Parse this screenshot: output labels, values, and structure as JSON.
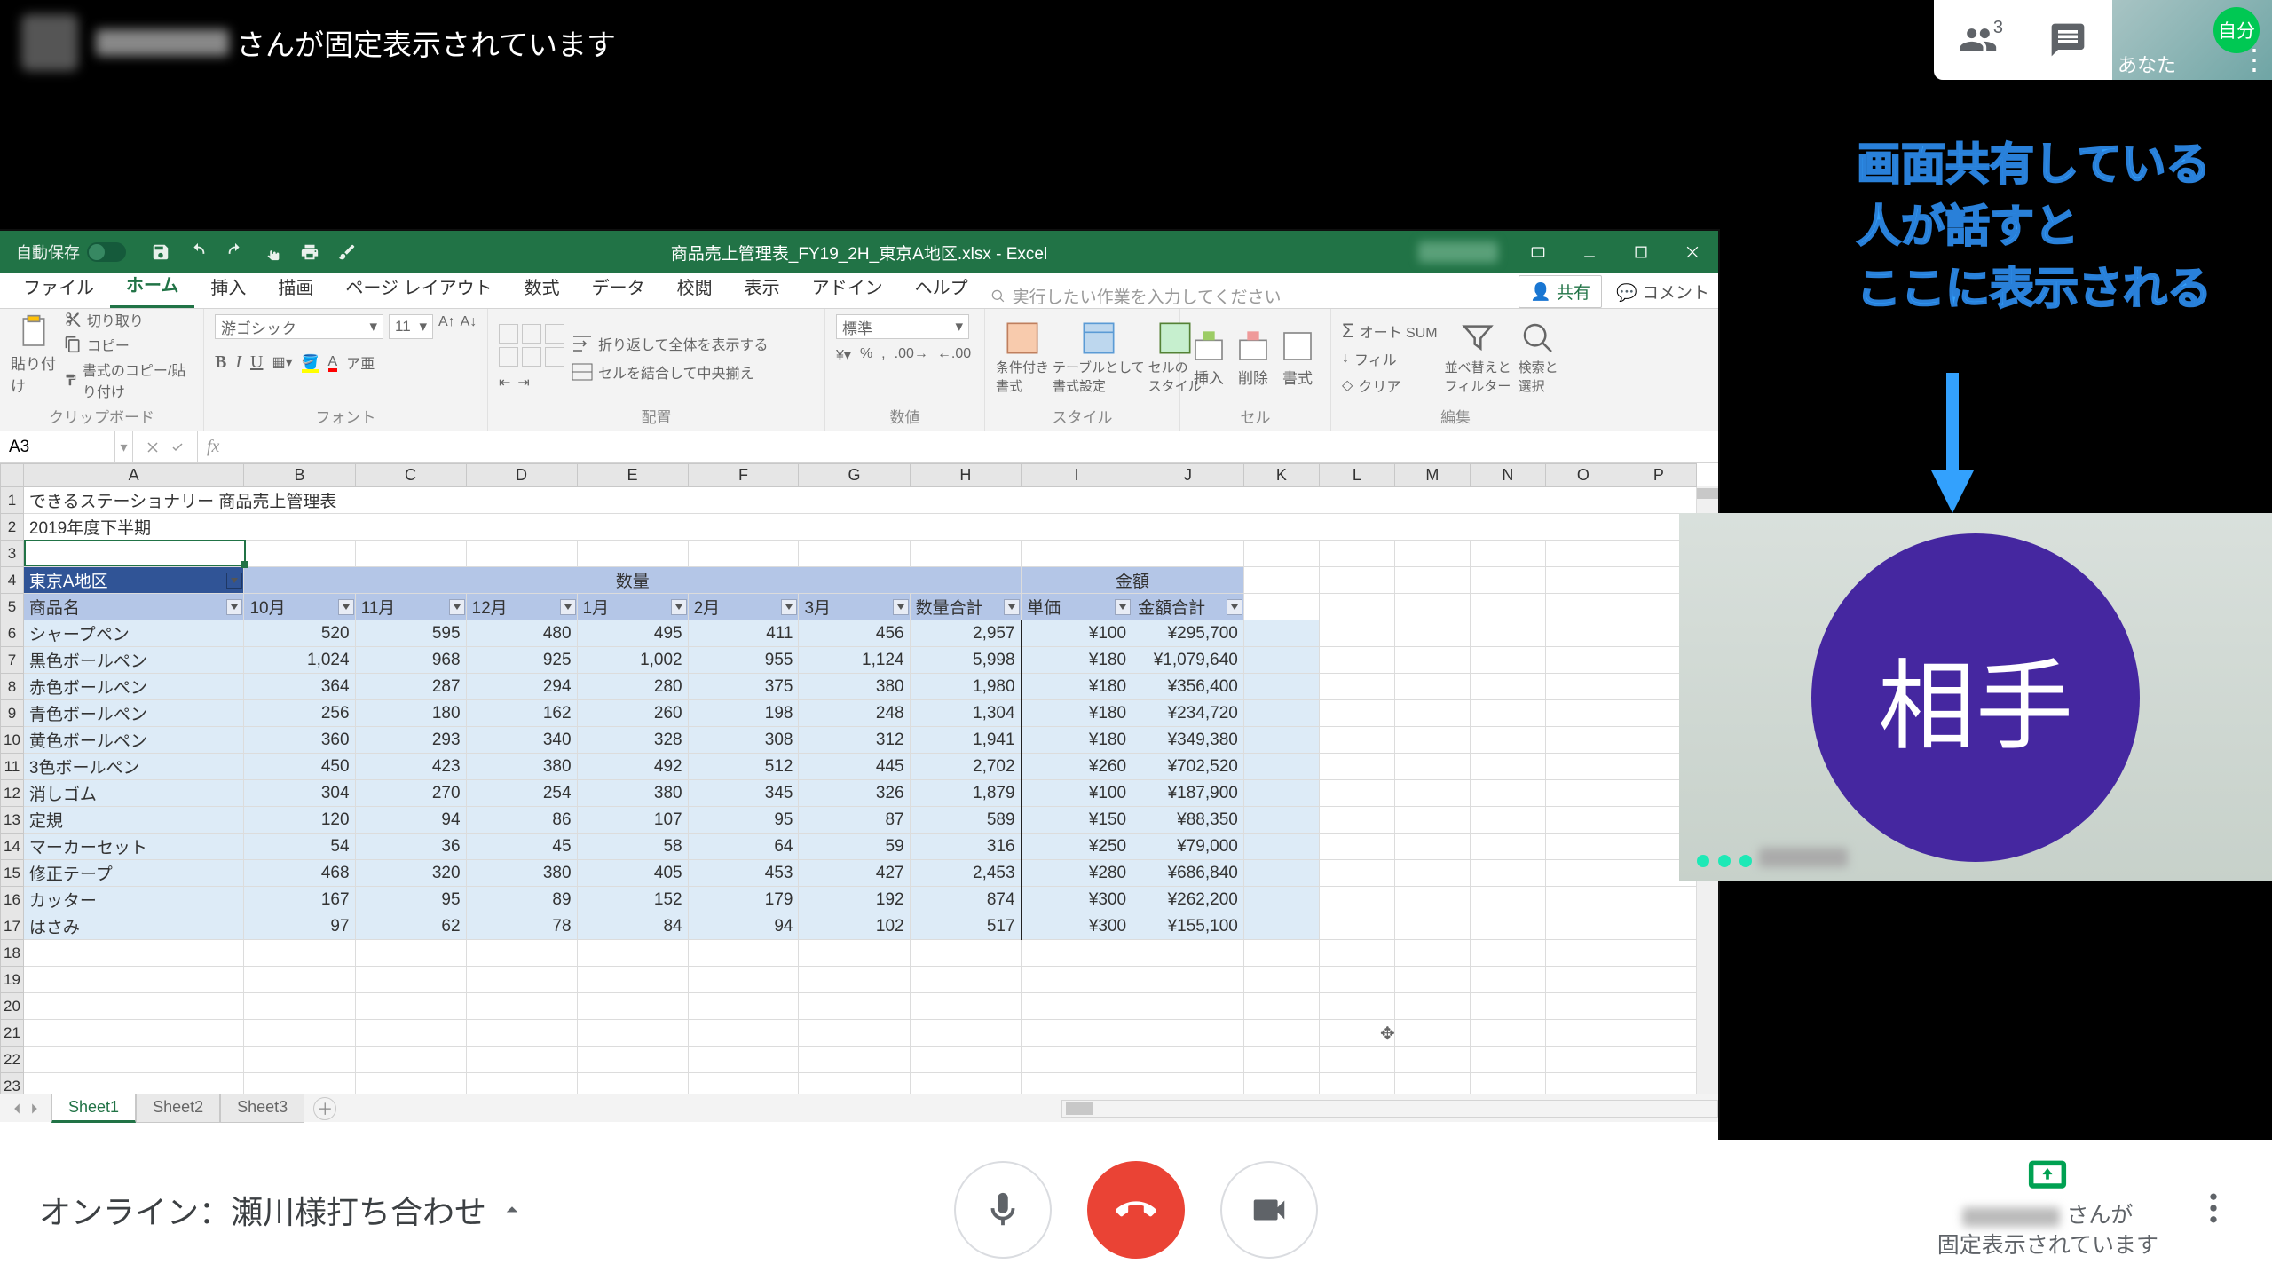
{
  "meet": {
    "pinned_text": "さんが固定表示されています",
    "self_label": "あなた",
    "self_badge": "自分",
    "participants_sup": "3",
    "meeting_title": "オンライン：瀬川様打ち合わせ",
    "guest_label": "相手",
    "bottom_status_suffix": "さんが",
    "bottom_status_line2": "固定表示されています",
    "annotation_line1": "画面共有している",
    "annotation_line2": "人が話すと",
    "annotation_line3": "ここに表示される"
  },
  "excel": {
    "title": "商品売上管理表_FY19_2H_東京A地区.xlsx  -  Excel",
    "autosave": "自動保存",
    "tabs": [
      "ファイル",
      "ホーム",
      "挿入",
      "描画",
      "ページ レイアウト",
      "数式",
      "データ",
      "校閲",
      "表示",
      "アドイン",
      "ヘルプ"
    ],
    "active_tab": "ホーム",
    "tell_me": "実行したい作業を入力してください",
    "share": "共有",
    "comments": "コメント",
    "ribbon": {
      "clipboard": {
        "paste": "貼り付け",
        "cut": "切り取り",
        "copy": "コピー",
        "format_painter": "書式のコピー/貼り付け",
        "label": "クリップボード"
      },
      "font": {
        "name": "游ゴシック",
        "size": "11",
        "label": "フォント"
      },
      "alignment": {
        "wrap": "折り返して全体を表示する",
        "merge": "セルを結合して中央揃え",
        "label": "配置"
      },
      "number": {
        "std": "標準",
        "label": "数値"
      },
      "styles": {
        "cond": "条件付き\n書式",
        "table": "テーブルとして\n書式設定",
        "cell": "セルの\nスタイル",
        "label": "スタイル"
      },
      "cells": {
        "insert": "挿入",
        "delete": "削除",
        "format": "書式",
        "label": "セル"
      },
      "editing": {
        "autosum": "オート SUM",
        "fill": "フィル",
        "clear": "クリア",
        "sort": "並べ替えと\nフィルター",
        "find": "検索と\n選択",
        "label": "編集"
      }
    },
    "namebox": "A3",
    "title_row": "できるステーショナリー 商品売上管理表",
    "subtitle_row": "2019年度下半期",
    "region": "東京A地区",
    "group_qty": "数量",
    "group_amt": "金額",
    "cols": [
      "商品名",
      "10月",
      "11月",
      "12月",
      "1月",
      "2月",
      "3月",
      "数量合計",
      "単価",
      "金額合計"
    ],
    "col_letters": [
      "A",
      "B",
      "C",
      "D",
      "E",
      "F",
      "G",
      "H",
      "I",
      "J",
      "K",
      "L",
      "M",
      "N",
      "O",
      "P"
    ],
    "data": [
      {
        "name": "シャープペン",
        "m": [
          520,
          595,
          480,
          495,
          411,
          456
        ],
        "sumq": "2,957",
        "unit": "¥100",
        "amt": "¥295,700"
      },
      {
        "name": "黒色ボールペン",
        "m": [
          1024,
          968,
          925,
          1002,
          955,
          1124
        ],
        "sumq": "5,998",
        "unit": "¥180",
        "amt": "¥1,079,640"
      },
      {
        "name": "赤色ボールペン",
        "m": [
          364,
          287,
          294,
          280,
          375,
          380
        ],
        "sumq": "1,980",
        "unit": "¥180",
        "amt": "¥356,400"
      },
      {
        "name": "青色ボールペン",
        "m": [
          256,
          180,
          162,
          260,
          198,
          248
        ],
        "sumq": "1,304",
        "unit": "¥180",
        "amt": "¥234,720"
      },
      {
        "name": "黄色ボールペン",
        "m": [
          360,
          293,
          340,
          328,
          308,
          312
        ],
        "sumq": "1,941",
        "unit": "¥180",
        "amt": "¥349,380"
      },
      {
        "name": "3色ボールペン",
        "m": [
          450,
          423,
          380,
          492,
          512,
          445
        ],
        "sumq": "2,702",
        "unit": "¥260",
        "amt": "¥702,520"
      },
      {
        "name": "消しゴム",
        "m": [
          304,
          270,
          254,
          380,
          345,
          326
        ],
        "sumq": "1,879",
        "unit": "¥100",
        "amt": "¥187,900"
      },
      {
        "name": "定規",
        "m": [
          120,
          94,
          86,
          107,
          95,
          87
        ],
        "sumq": "589",
        "unit": "¥150",
        "amt": "¥88,350"
      },
      {
        "name": "マーカーセット",
        "m": [
          54,
          36,
          45,
          58,
          64,
          59
        ],
        "sumq": "316",
        "unit": "¥250",
        "amt": "¥79,000"
      },
      {
        "name": "修正テープ",
        "m": [
          468,
          320,
          380,
          405,
          453,
          427
        ],
        "sumq": "2,453",
        "unit": "¥280",
        "amt": "¥686,840"
      },
      {
        "name": "カッター",
        "m": [
          167,
          95,
          89,
          152,
          179,
          192
        ],
        "sumq": "874",
        "unit": "¥300",
        "amt": "¥262,200"
      },
      {
        "name": "はさみ",
        "m": [
          97,
          62,
          78,
          84,
          94,
          102
        ],
        "sumq": "517",
        "unit": "¥300",
        "amt": "¥155,100"
      }
    ],
    "sheets": [
      "Sheet1",
      "Sheet2",
      "Sheet3"
    ],
    "active_sheet": "Sheet1"
  }
}
